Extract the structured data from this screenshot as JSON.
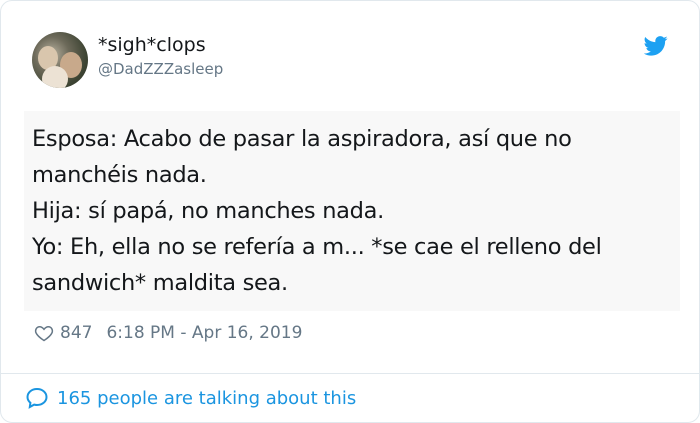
{
  "tweet": {
    "author_name": "*sigh*clops",
    "author_handle": "@DadZZZasleep",
    "text_lines": [
      "Esposa: Acabo de pasar la aspiradora, así que no",
      "manchéis nada.",
      "Hija: sí papá, no manches nada.",
      "Yo: Eh, ella no se refería a m... *se cae el relleno del",
      "sandwich* maldita sea."
    ],
    "likes": "847",
    "timestamp": "6:18 PM - Apr 16, 2019",
    "talking_about": "165 people are talking about this"
  },
  "icons": {
    "brand": "twitter-bird-icon",
    "like": "heart-icon",
    "reply": "speech-bubble-icon"
  },
  "colors": {
    "twitter_blue": "#1da1f2",
    "link_blue": "#1b95e0",
    "muted_gray": "#657786",
    "text": "#14171a",
    "border": "#e1e8ed"
  }
}
